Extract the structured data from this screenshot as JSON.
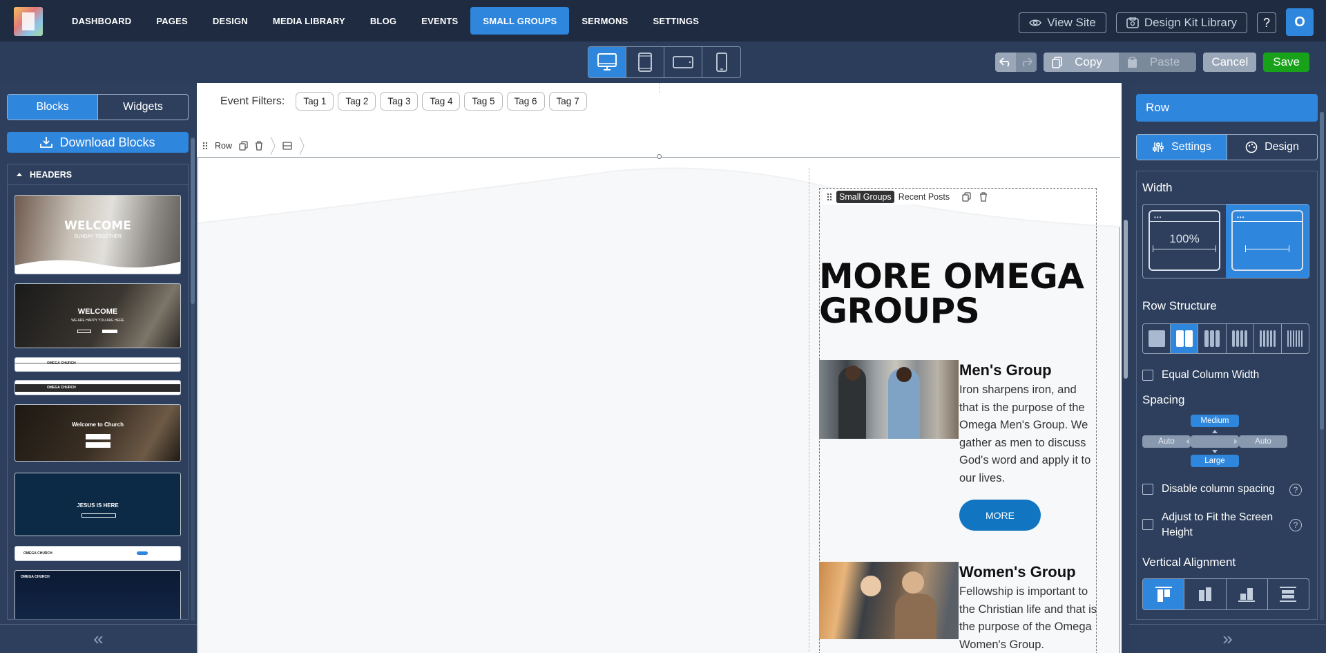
{
  "nav": {
    "items": [
      {
        "label": "DASHBOARD",
        "active": false
      },
      {
        "label": "PAGES",
        "active": false
      },
      {
        "label": "DESIGN",
        "active": false
      },
      {
        "label": "MEDIA LIBRARY",
        "active": false
      },
      {
        "label": "BLOG",
        "active": false
      },
      {
        "label": "EVENTS",
        "active": false
      },
      {
        "label": "SMALL GROUPS",
        "active": true
      },
      {
        "label": "SERMONS",
        "active": false
      },
      {
        "label": "SETTINGS",
        "active": false
      }
    ],
    "view_site": "View Site",
    "design_kit": "Design Kit Library",
    "help": "?",
    "avatar": "O"
  },
  "toolbar": {
    "copy": "Copy",
    "paste": "Paste",
    "cancel": "Cancel",
    "save": "Save"
  },
  "left": {
    "tab_blocks": "Blocks",
    "tab_widgets": "Widgets",
    "download": "Download Blocks",
    "section": "HEADERS",
    "thumbs": [
      {
        "caption": "WELCOME",
        "sub": "SUNDAY TOGETHER"
      },
      {
        "caption": "WELCOME",
        "sub": "WE ARE HAPPY YOU ARE HERE"
      },
      {
        "caption": "OMEGA CHURCH",
        "sub": ""
      },
      {
        "caption": "OMEGA CHURCH",
        "sub": ""
      },
      {
        "caption": "Welcome to Church",
        "sub": ""
      },
      {
        "caption": "JESUS IS HERE",
        "sub": ""
      },
      {
        "caption": "OMEGA CHURCH",
        "sub": ""
      },
      {
        "caption": "OMEGA CHURCH",
        "sub": ""
      }
    ],
    "footer": "«"
  },
  "canvas": {
    "filters_label": "Event Filters:",
    "tags": [
      "Tag 1",
      "Tag 2",
      "Tag 3",
      "Tag 4",
      "Tag 5",
      "Tag 6",
      "Tag 7"
    ],
    "row_label": "Row",
    "module_chip": "Small Groups",
    "module_name": "Recent Posts",
    "title": "MORE OMEGA GROUPS",
    "groups": [
      {
        "name": "Men's Group",
        "desc": "Iron sharpens iron, and that is the purpose of the Omega Men's Group. We gather as men to discuss God's word and apply it to our lives.",
        "button": "MORE"
      },
      {
        "name": "Women's Group",
        "desc": "Fellowship is important to the Christian life and that is the purpose of the Omega Women's Group."
      }
    ]
  },
  "right": {
    "title": "Row",
    "tab_settings": "Settings",
    "tab_design": "Design",
    "width_label": "Width",
    "width_full": "100%",
    "row_structure": "Row Structure",
    "equal_width": "Equal Column Width",
    "spacing": "Spacing",
    "spacing_top": "Medium",
    "spacing_left": "Auto",
    "spacing_right": "Auto",
    "spacing_bottom": "Large",
    "disable_spacing": "Disable column spacing",
    "fit_screen": "Adjust to Fit the Screen Height",
    "vertical_alignment": "Vertical Alignment",
    "footer": "»"
  }
}
